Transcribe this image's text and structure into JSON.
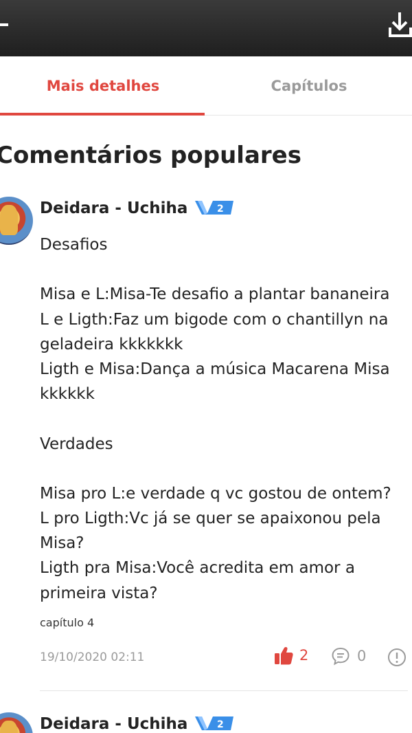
{
  "tabs": [
    {
      "label": "Mais detalhes",
      "active": true
    },
    {
      "label": "Capítulos",
      "active": false
    }
  ],
  "section_title": "Comentários populares",
  "comments": [
    {
      "author": "Deidara - Uchiha",
      "badge_level": "2",
      "lines": [
        "Desafios",
        "",
        "Misa e L:Misa-Te desafio a plantar bananeira",
        "L e Ligth:Faz um bigode com o chantillyn na",
        "geladeira kkkkkkk",
        "Ligth e Misa:Dança a música Macarena Misa",
        "kkkkkk",
        "",
        "Verdades",
        "",
        "Misa pro L:e verdade q vc gostou de ontem?",
        "L pro Ligth:Vc já se quer se apaixonou pela",
        "Misa?",
        "Ligth pra Misa:Você acredita em amor a",
        "primeira vista?"
      ],
      "chapter": "capítulo 4",
      "date": "19/10/2020 02:11",
      "likes": "2",
      "replies": "0"
    },
    {
      "author": "Deidara - Uchiha",
      "badge_level": "2"
    }
  ],
  "colors": {
    "accent": "#e0473f",
    "badge": "#3a8fe8",
    "topbar": "#2a2a2a",
    "muted": "#9a9a9a"
  },
  "icons": [
    "back-icon",
    "download-icon",
    "thumbs-up-icon",
    "reply-bubble-icon",
    "report-icon"
  ]
}
